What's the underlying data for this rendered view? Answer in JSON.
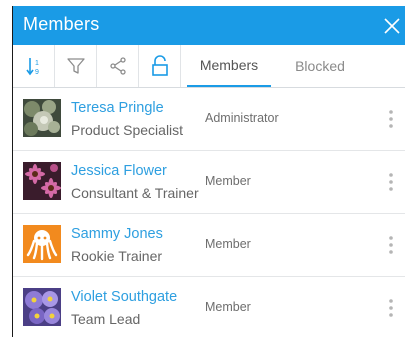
{
  "header": {
    "title": "Members"
  },
  "toolbar": {
    "tools": [
      {
        "icon": "sort-icon"
      },
      {
        "icon": "filter-icon"
      },
      {
        "icon": "share-icon"
      },
      {
        "icon": "unlock-icon"
      }
    ],
    "tabs": [
      {
        "label": "Members",
        "active": true
      },
      {
        "label": "Blocked",
        "active": false
      }
    ]
  },
  "members": [
    {
      "name": "Teresa Pringle",
      "job": "Product Specialist",
      "role": "Administrator",
      "avatar": "blurred-flowers"
    },
    {
      "name": "Jessica Flower",
      "job": "Consultant & Trainer",
      "role": "Member",
      "avatar": "pink-daisies"
    },
    {
      "name": "Sammy Jones",
      "job": "Rookie Trainer",
      "role": "Member",
      "avatar": "octopus"
    },
    {
      "name": "Violet Southgate",
      "job": "Team Lead",
      "role": "Member",
      "avatar": "purple-pansies"
    }
  ],
  "colors": {
    "accent": "#1a9be6",
    "name_link": "#2e9fe0",
    "octopus_bg": "#f28a1e"
  }
}
